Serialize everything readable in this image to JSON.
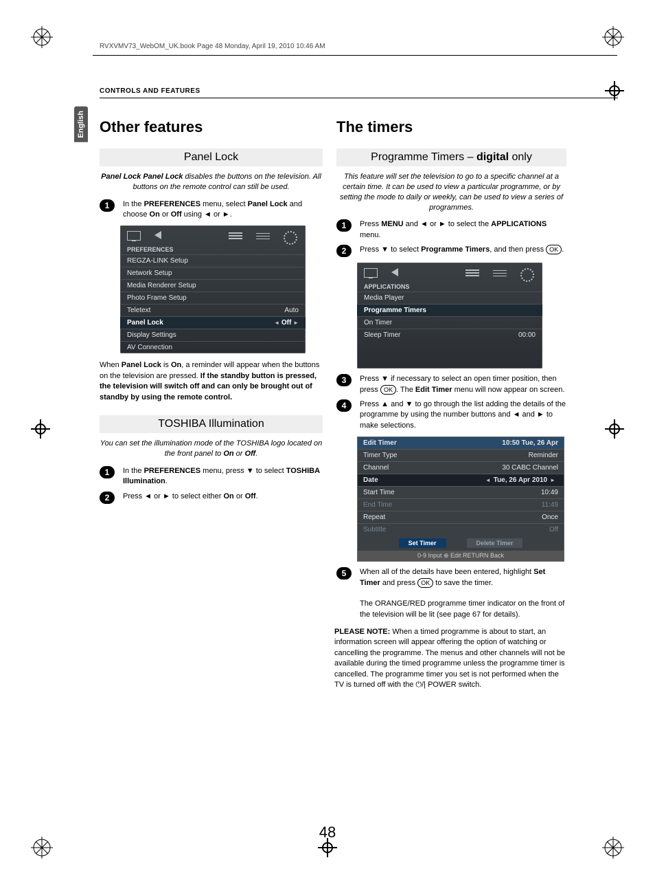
{
  "runhead": "RVXVMV73_WebOM_UK.book  Page 48  Monday, April 19, 2010  10:46 AM",
  "section_header": "CONTROLS AND FEATURES",
  "lang_tab": "English",
  "page_number": "48",
  "left": {
    "h1": "Other features",
    "panel_lock": {
      "title": "Panel Lock",
      "intro": "Panel Lock disables the buttons on the television. All buttons on the remote control can still be used.",
      "step1_pre": "In the ",
      "step1_b1": "PREFERENCES",
      "step1_mid": " menu, select ",
      "step1_b2": "Panel Lock",
      "step1_mid2": " and choose ",
      "step1_b3": "On",
      "step1_or": " or ",
      "step1_b4": "Off",
      "step1_end": " using ◄ or ►.",
      "after_pre": "When ",
      "after_b1": "Panel Lock",
      "after_mid": " is ",
      "after_b2": "On",
      "after_mid2": ", a reminder will appear when the buttons on the television are pressed. ",
      "after_b3": "If the standby button is pressed, the television will switch off and can only be brought out of standby by using the remote control."
    },
    "pref_osd": {
      "title": "PREFERENCES",
      "rows": [
        {
          "label": "REGZA-LINK Setup",
          "value": ""
        },
        {
          "label": "Network Setup",
          "value": ""
        },
        {
          "label": "Media Renderer Setup",
          "value": ""
        },
        {
          "label": "Photo Frame Setup",
          "value": ""
        },
        {
          "label": "Teletext",
          "value": "Auto"
        },
        {
          "label": "Panel Lock",
          "value": "Off",
          "sel": true,
          "arrows": true
        },
        {
          "label": "Display Settings",
          "value": ""
        },
        {
          "label": "AV Connection",
          "value": ""
        }
      ]
    },
    "illum": {
      "title": "TOSHIBA Illumination",
      "intro": "You can set the illumination mode of the TOSHIBA logo located on the front panel to On or Off.",
      "s1_pre": "In the ",
      "s1_b1": "PREFERENCES",
      "s1_mid": " menu, press ▼ to select ",
      "s1_b2": "TOSHIBA Illumination",
      "s1_end": ".",
      "s2_pre": "Press ◄ or ► to select either ",
      "s2_b1": "On",
      "s2_or": " or ",
      "s2_b2": "Off",
      "s2_end": "."
    }
  },
  "right": {
    "h1": "The timers",
    "progtimers": {
      "title_a": "Programme Timers – ",
      "title_b": "digital",
      "title_c": " only",
      "intro": "This feature will set the television to go to a specific channel at a certain time. It can be used to view a particular programme, or by setting the mode to daily or weekly, can be used to view a series of programmes.",
      "s1_pre": "Press ",
      "s1_b1": "MENU",
      "s1_mid": " and ◄ or ► to select the ",
      "s1_b2": "APPLICATIONS",
      "s1_end": " menu.",
      "s2_pre": "Press ▼ to select ",
      "s2_b1": "Programme Timers",
      "s2_end": ", and then press ",
      "ok": "OK",
      "s3_pre": "Press ▼ if necessary to select an open timer position, then press ",
      "s3_mid": ". The ",
      "s3_b1": "Edit Timer",
      "s3_end": " menu will now appear on screen.",
      "s4": "Press ▲ and ▼ to go through the list adding the details of the programme by using the number buttons and ◄ and ► to make selections.",
      "s5_pre": "When all of the details have been entered, highlight ",
      "s5_b1": "Set Timer",
      "s5_mid": " and press ",
      "s5_end": " to save the timer.",
      "s5_p2": "The ORANGE/RED programme timer indicator on the front of the television will be lit (see page 67 for details).",
      "note_label": "PLEASE NOTE:",
      "note": " When a timed programme is about to start, an information screen will appear offering the option of watching or cancelling the programme. The menus and other channels will not be available during the timed programme unless the programme timer is cancelled. The programme timer you set is not performed when the TV is turned off with the ⏻/| POWER switch."
    },
    "apps_osd": {
      "title": "APPLICATIONS",
      "rows": [
        {
          "label": "Media Player",
          "value": ""
        },
        {
          "label": "Programme Timers",
          "value": "",
          "sel": true
        },
        {
          "label": "On Timer",
          "value": ""
        },
        {
          "label": "Sleep Timer",
          "value": "00:00"
        }
      ]
    },
    "edit_osd": {
      "header_l": "Edit Timer",
      "header_r": "10:50 Tue, 26 Apr",
      "rows": [
        {
          "label": "Timer Type",
          "value": "Reminder"
        },
        {
          "label": "Channel",
          "value": "30 CABC Channel"
        },
        {
          "label": "Date",
          "value": "Tue, 26 Apr 2010",
          "sel": true,
          "arrows": true
        },
        {
          "label": "Start Time",
          "value": "10:49"
        },
        {
          "label": "End Time",
          "value": "11:49",
          "dis": true
        },
        {
          "label": "Repeat",
          "value": "Once"
        },
        {
          "label": "Subtitle",
          "value": "Off",
          "dis": true
        }
      ],
      "btn_set": "Set Timer",
      "btn_del": "Delete Timer",
      "footer": "0-9  Input   ⊕ Edit   RETURN  Back"
    }
  }
}
